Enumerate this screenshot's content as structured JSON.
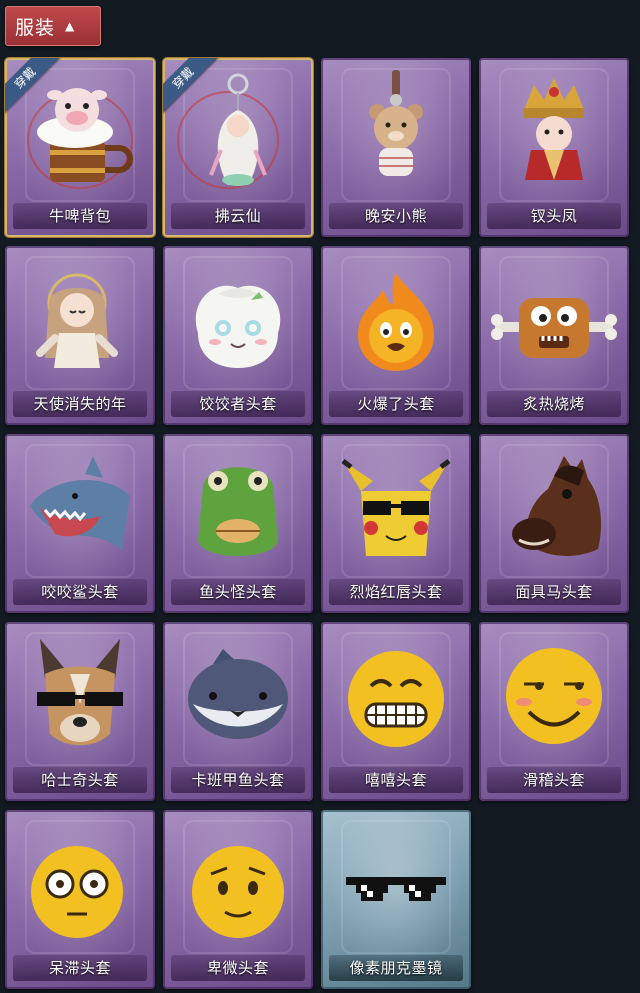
{
  "header": {
    "tab_label": "服装",
    "chevron_icon": "chevron-up-icon"
  },
  "equipped_label": "穿戴",
  "items": [
    {
      "name": "牛啤背包",
      "art": "cow-mug-backpack",
      "equipped": true
    },
    {
      "name": "拂云仙",
      "art": "fairy-charm",
      "equipped": true
    },
    {
      "name": "晚安小熊",
      "art": "bear-charm"
    },
    {
      "name": "钗头凤",
      "art": "phoenix-crown-doll"
    },
    {
      "name": "天使消失的年",
      "art": "angel-doll"
    },
    {
      "name": "饺饺者头套",
      "art": "dumpling-head"
    },
    {
      "name": "火爆了头套",
      "art": "fire-head"
    },
    {
      "name": "炙热烧烤",
      "art": "roast-meat-head"
    },
    {
      "name": "咬咬鲨头套",
      "art": "shark-head"
    },
    {
      "name": "鱼头怪头套",
      "art": "fish-monster-head"
    },
    {
      "name": "烈焰红唇头套",
      "art": "yellow-mascot-head"
    },
    {
      "name": "面具马头套",
      "art": "horse-head"
    },
    {
      "name": "哈士奇头套",
      "art": "husky-head"
    },
    {
      "name": "卡班甲鱼头套",
      "art": "pufferfish-head"
    },
    {
      "name": "嘻嘻头套",
      "art": "grin-emoji-head"
    },
    {
      "name": "滑稽头套",
      "art": "smirk-emoji-head"
    },
    {
      "name": "呆滞头套",
      "art": "dazed-emoji-head"
    },
    {
      "name": "卑微头套",
      "art": "shy-emoji-head"
    },
    {
      "name": "像素朋克墨镜",
      "art": "pixel-sunglasses",
      "rarity": "blue"
    }
  ]
}
